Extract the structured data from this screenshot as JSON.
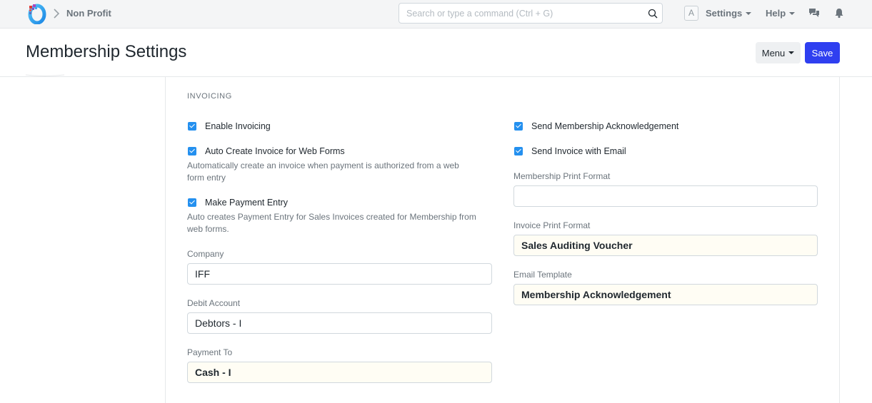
{
  "navbar": {
    "breadcrumb": "Non Profit",
    "search_placeholder": "Search or type a command (Ctrl + G)",
    "avatar_letter": "A",
    "settings_label": "Settings",
    "help_label": "Help"
  },
  "page": {
    "title": "Membership Settings",
    "menu_label": "Menu",
    "save_label": "Save"
  },
  "section": {
    "heading": "INVOICING"
  },
  "left": {
    "enable_invoicing": {
      "label": "Enable Invoicing",
      "checked": true
    },
    "auto_create_invoice": {
      "label": "Auto Create Invoice for Web Forms",
      "checked": true,
      "description_line1": "Automatically create an invoice when payment is authorized from a web",
      "description_line2": "form entry"
    },
    "make_payment_entry": {
      "label": "Make Payment Entry",
      "checked": true,
      "description_line1": "Auto creates Payment Entry for Sales Invoices created for Membership from",
      "description_line2": "web forms."
    },
    "company": {
      "label": "Company",
      "value": "IFF"
    },
    "debit_account": {
      "label": "Debit Account",
      "value": "Debtors - I"
    },
    "payment_to": {
      "label": "Payment To",
      "value": "Cash - I"
    }
  },
  "right": {
    "send_acknowledgement": {
      "label": "Send Membership Acknowledgement",
      "checked": true
    },
    "send_invoice_email": {
      "label": "Send Invoice with Email",
      "checked": true
    },
    "membership_print_format": {
      "label": "Membership Print Format",
      "value": ""
    },
    "invoice_print_format": {
      "label": "Invoice Print Format",
      "value": "Sales Auditing Voucher"
    },
    "email_template": {
      "label": "Email Template",
      "value": "Membership Acknowledgement"
    }
  },
  "colors": {
    "primary": "#2f3ff0",
    "checkbox": "#2490ef",
    "navbar_bg": "#f4f5f6",
    "link_field_bg": "#fffdf4"
  },
  "icons": [
    "app-logo-icon",
    "chevron-right-icon",
    "search-icon",
    "comment-icon",
    "bell-icon"
  ]
}
